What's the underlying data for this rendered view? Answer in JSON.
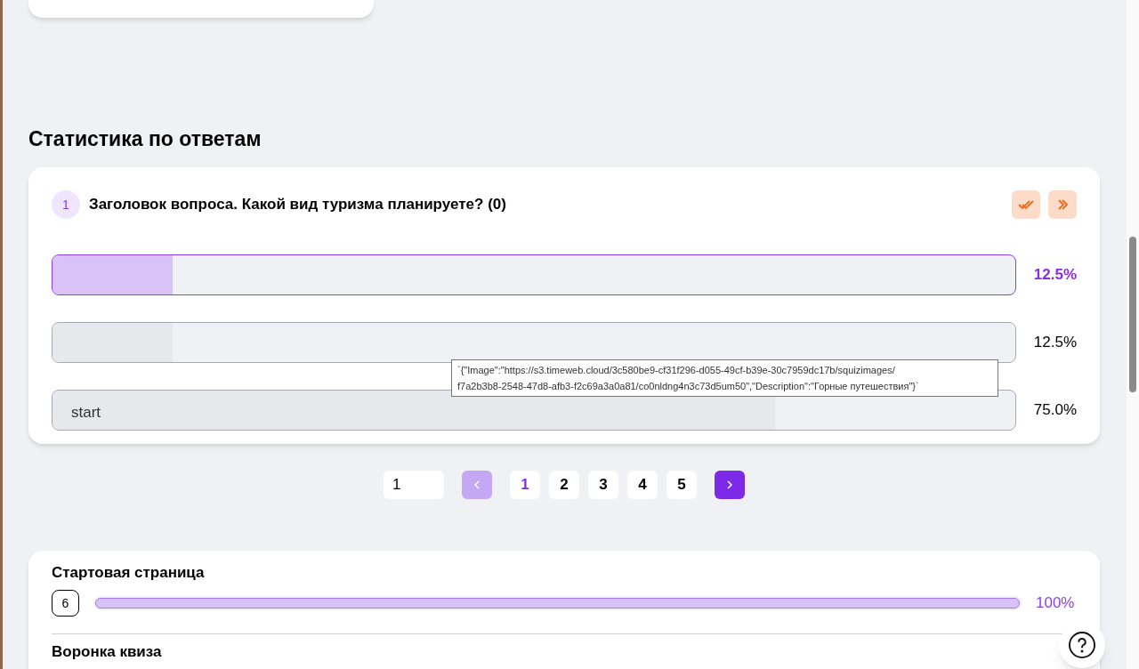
{
  "section_title": "Статистика по ответам",
  "question": {
    "number": "1",
    "title": "Заголовок вопроса. Какой вид туризма планируете? (0)"
  },
  "answers": [
    {
      "level": 0.125,
      "percent": "12.5%",
      "selected": true
    },
    {
      "level": 0.125,
      "percent": "12.5%",
      "selected": false
    },
    {
      "label": "start",
      "level": 0.75,
      "percent": "75.0%",
      "selected": false
    }
  ],
  "tooltip": "`{\"Image\":\"https://s3.timeweb.cloud/3c580be9-cf31f296-d055-49cf-b39e-30c7959dc17b/squizimages/\nf7a2b3b8-2548-47d8-afb3-f2c69a3a0a81/co0nldng4n3c73d5um50\",\"Description\":\"Горные путешествия\"}`",
  "pagination": {
    "page_input": "1",
    "prev_disabled": true,
    "pages": [
      {
        "label": "1",
        "selected": true
      },
      {
        "label": "2",
        "selected": false
      },
      {
        "label": "3",
        "selected": false
      },
      {
        "label": "4",
        "selected": false
      },
      {
        "label": "5",
        "selected": false
      }
    ]
  },
  "funnel": {
    "title": "Стартовая страница",
    "count": "6",
    "level": 1,
    "percent": "100%",
    "next_title": "Воронка квиза"
  }
}
